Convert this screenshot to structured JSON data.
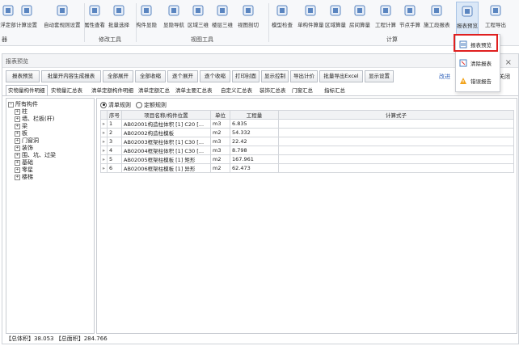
{
  "ribbon": {
    "buttons": [
      {
        "label": "浮定部",
        "icon": "anchor-icon"
      },
      {
        "label": "计算设置",
        "icon": "calc-settings-icon"
      },
      {
        "label": "自动套规则设置",
        "icon": "rule-settings-icon"
      },
      {
        "label": "属性查看",
        "icon": "lightbulb-icon"
      },
      {
        "label": "批量选择",
        "icon": "filter-icon"
      },
      {
        "label": "构件显隐",
        "icon": "component-visibility-icon"
      },
      {
        "label": "显隐导航",
        "icon": "tree-navigation-icon"
      },
      {
        "label": "区域三维",
        "icon": "region-3d-icon"
      },
      {
        "label": "楼层三维",
        "icon": "floor-3d-icon"
      },
      {
        "label": "视图剖切",
        "icon": "view-section-icon"
      },
      {
        "label": "模型检查",
        "icon": "model-check-icon"
      },
      {
        "label": "单构件算量",
        "icon": "single-calc-icon"
      },
      {
        "label": "区域算量",
        "icon": "region-calc-icon"
      },
      {
        "label": "房间算量",
        "icon": "room-calc-icon"
      },
      {
        "label": "工程计算",
        "icon": "sigma-icon"
      },
      {
        "label": "节点手算",
        "icon": "node-manual-icon"
      },
      {
        "label": "施工段报表",
        "icon": "stage-report-icon"
      },
      {
        "label": "报表预览",
        "icon": "report-preview-icon"
      },
      {
        "label": "工程导出",
        "icon": "export-icon"
      }
    ],
    "groups": [
      "器",
      "修改工具",
      "视图工具",
      "计算"
    ],
    "dropdown": [
      {
        "label": "报表预览",
        "icon": "report-preview-icon"
      },
      {
        "label": "清除报表",
        "icon": "clear-report-icon"
      },
      {
        "label": "错误报告",
        "icon": "warning-icon"
      }
    ]
  },
  "panel": {
    "title": "报表预览",
    "close": "×",
    "toolbar": [
      "报表预览",
      "批量开内容生成报表",
      "全部展开",
      "全部收缩",
      "逐个展开",
      "逐个收缩",
      "打印封面",
      "显示控制",
      "导出计价",
      "批量导出Excel",
      "显示设置"
    ],
    "toolbar_right": [
      "改进",
      "关闭"
    ],
    "tabs": [
      "实物量构件明细",
      "实物量汇总表",
      "清单定额构件明细",
      "清单定额汇总",
      "清单主要汇总表",
      "自定义汇总表",
      "装饰汇总表",
      "门窗汇总",
      "指标汇总"
    ],
    "tree": {
      "root": "所有构件",
      "children": [
        "柱",
        "墙、栏板(杆)",
        "梁",
        "板",
        "门窗洞",
        "装饰",
        "围、坑、过梁",
        "基础",
        "零星",
        "楼梯"
      ]
    },
    "radio": {
      "option1": "清单规则",
      "option2": "定额规则",
      "selected": "清单规则"
    },
    "table": {
      "headers": [
        "序号",
        "项目名称/构件位置",
        "单位",
        "工程量",
        "计算式子"
      ],
      "rows": [
        {
          "no": "1",
          "name": "AB02001构造柱体积 [1] C20 [...",
          "unit": "m3",
          "qty": "6.835",
          "formula": ""
        },
        {
          "no": "2",
          "name": "AB02002构造柱模板",
          "unit": "m2",
          "qty": "54.332",
          "formula": ""
        },
        {
          "no": "3",
          "name": "AB02003框架柱体积 [1] C30 [...",
          "unit": "m3",
          "qty": "22.42",
          "formula": ""
        },
        {
          "no": "4",
          "name": "AB02004框架柱体积 [1] C30 [...",
          "unit": "m3",
          "qty": "8.798",
          "formula": ""
        },
        {
          "no": "5",
          "name": "AB02005框架柱模板 [1] 矩形",
          "unit": "m2",
          "qty": "167.961",
          "formula": ""
        },
        {
          "no": "6",
          "name": "AB02006框架柱模板 [1] 异形",
          "unit": "m2",
          "qty": "62.473",
          "formula": ""
        }
      ]
    },
    "status": "【总体积】38.053 【总面积】284.766"
  }
}
